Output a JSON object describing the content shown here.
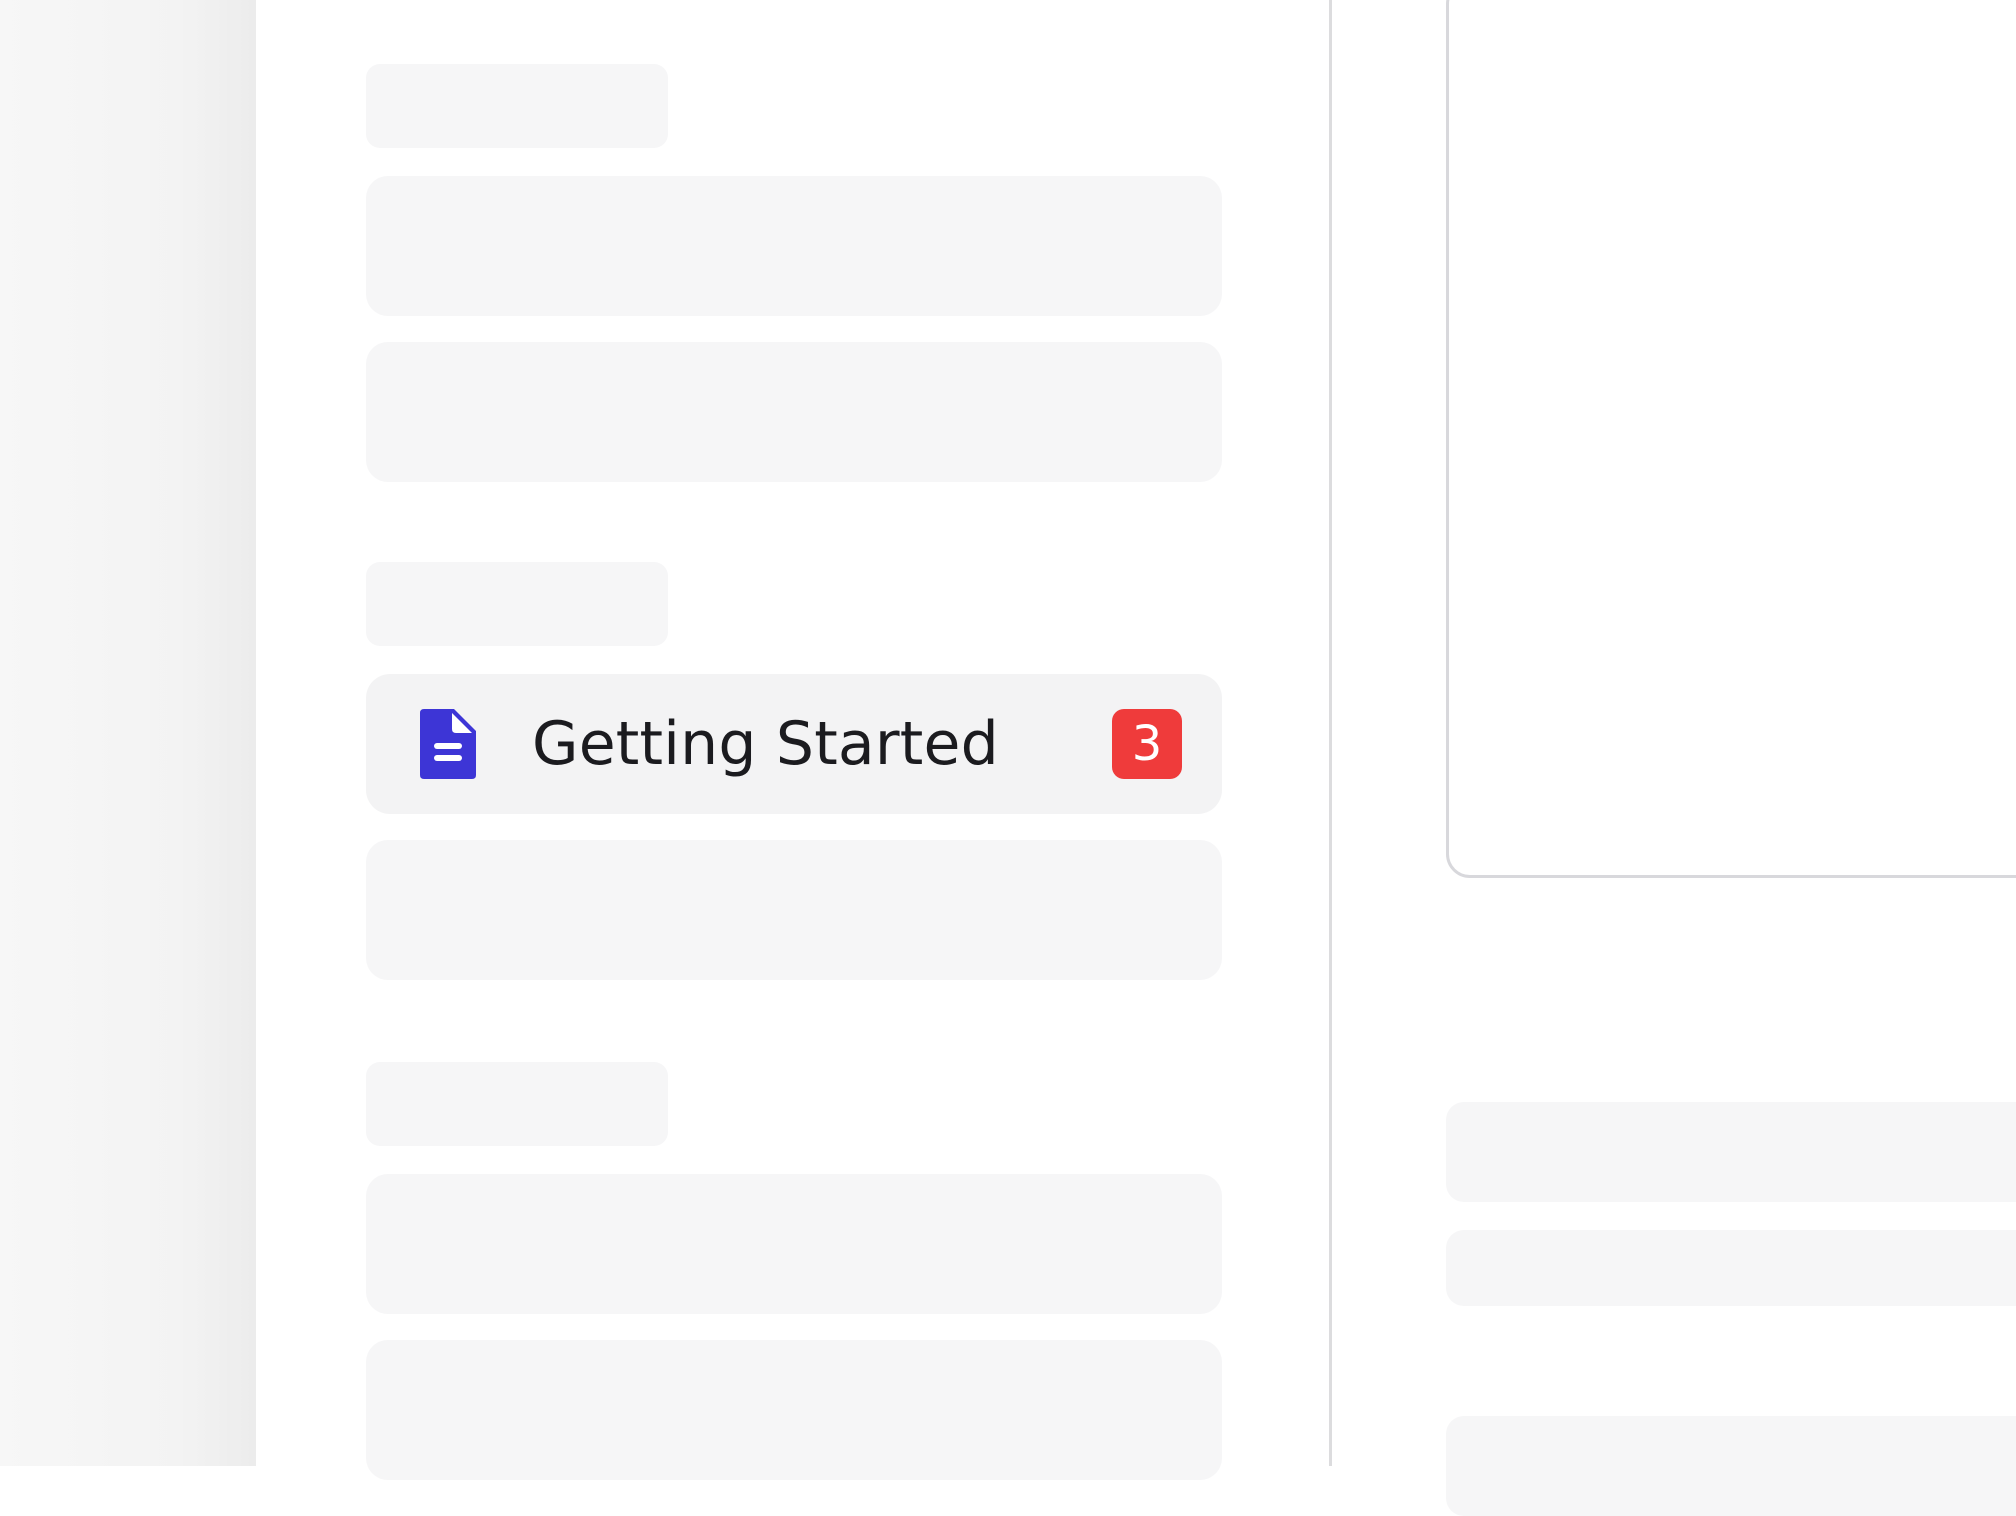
{
  "sidebar": {
    "active_item": {
      "label": "Getting Started",
      "badge_count": "3",
      "icon": "document-icon",
      "icon_color": "#3d35d6",
      "badge_color": "#ef3b3b"
    }
  },
  "colors": {
    "skeleton": "#f6f6f7",
    "active_bg": "#f3f3f4",
    "divider": "#dcdcde",
    "text": "#1b1b1f"
  }
}
